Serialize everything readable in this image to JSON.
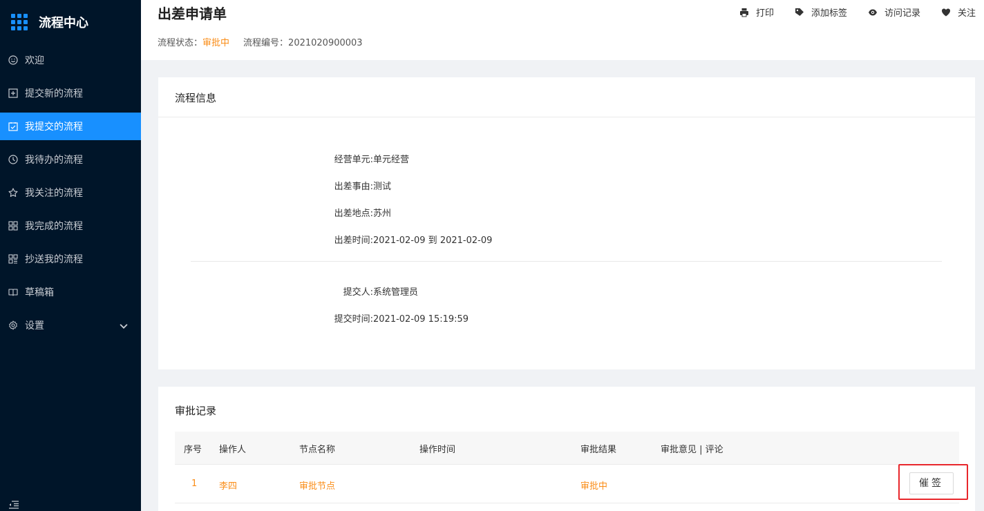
{
  "sidebar": {
    "title": "流程中心",
    "items": [
      {
        "label": "欢迎",
        "icon": "smile-icon"
      },
      {
        "label": "提交新的流程",
        "icon": "plus-square-icon"
      },
      {
        "label": "我提交的流程",
        "icon": "check-square-icon",
        "active": true
      },
      {
        "label": "我待办的流程",
        "icon": "clock-icon"
      },
      {
        "label": "我关注的流程",
        "icon": "star-icon"
      },
      {
        "label": "我完成的流程",
        "icon": "appstore-icon"
      },
      {
        "label": "抄送我的流程",
        "icon": "cc-grid-icon"
      },
      {
        "label": "草稿箱",
        "icon": "book-icon"
      },
      {
        "label": "设置",
        "icon": "gear-icon"
      }
    ]
  },
  "header": {
    "title": "出差申请单",
    "status_label": "流程状态：",
    "status_value": "审批中",
    "number_label": "流程编号：",
    "number_value": "2021020900003",
    "actions": [
      {
        "label": "打印",
        "icon": "printer-icon"
      },
      {
        "label": "添加标签",
        "icon": "tag-icon"
      },
      {
        "label": "访问记录",
        "icon": "eye-icon"
      },
      {
        "label": "关注",
        "icon": "heart-icon"
      }
    ]
  },
  "info": {
    "title": "流程信息",
    "fields": [
      {
        "label": "经营单元:",
        "value": "单元经营"
      },
      {
        "label": "出差事由:",
        "value": "测试"
      },
      {
        "label": "出差地点:",
        "value": "苏州"
      },
      {
        "label": "出差时间:",
        "value": "2021-02-09 到 2021-02-09"
      }
    ],
    "submit_fields": [
      {
        "label": "提交人:",
        "value": "系统管理员"
      },
      {
        "label": "提交时间:",
        "value": "2021-02-09 15:19:59"
      }
    ]
  },
  "approval": {
    "title": "审批记录",
    "columns": [
      "序号",
      "操作人",
      "节点名称",
      "操作时间",
      "审批结果",
      "审批意见 | 评论"
    ],
    "rows": [
      {
        "index": "1",
        "operator": "李四",
        "node": "审批节点",
        "time": "",
        "result": "审批中",
        "comment": ""
      }
    ],
    "urge_button": "催签"
  },
  "colors": {
    "sidebar_bg": "#001529",
    "accent": "#1890ff",
    "orange": "#fa8c16",
    "highlight": "#e8262b"
  }
}
